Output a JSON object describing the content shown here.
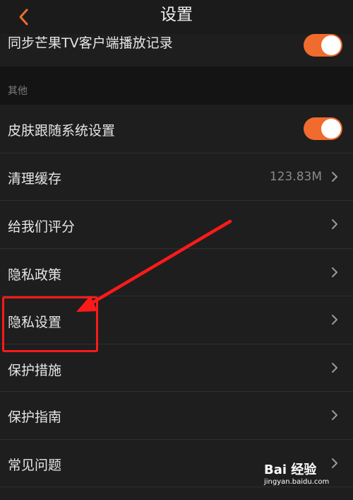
{
  "header": {
    "title": "设置",
    "back_icon": "chevron-left-icon",
    "accent_color": "#f06b2d"
  },
  "settings": {
    "sync_tv": {
      "label": "同步芒果TV客户端播放记录",
      "toggle_on": true
    },
    "section_other": {
      "label": "其他"
    },
    "skin_follow": {
      "label": "皮肤跟随系统设置",
      "toggle_on": true
    },
    "clear_cache": {
      "label": "清理缓存",
      "value": "123.83M"
    },
    "rate_us": {
      "label": "给我们评分"
    },
    "privacy_policy": {
      "label": "隐私政策"
    },
    "privacy_settings": {
      "label": "隐私设置"
    },
    "protection_measures": {
      "label": "保护措施"
    },
    "protection_guide": {
      "label": "保护指南"
    },
    "faq": {
      "label": "常见问题"
    }
  },
  "annotation": {
    "highlight_color": "#ff1a1a"
  },
  "watermark": {
    "brand": "Bai 经验",
    "url": "jingyan.baidu.com"
  }
}
